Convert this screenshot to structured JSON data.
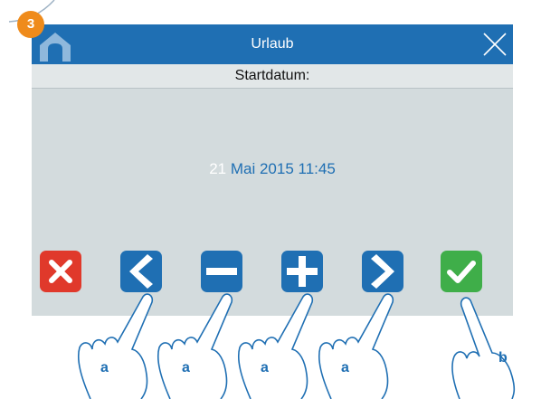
{
  "step_badge": "3",
  "titlebar": {
    "title": "Urlaub",
    "home_icon": "home-icon",
    "close_icon": "close-icon"
  },
  "subheader": {
    "label": "Startdatum:"
  },
  "datetime": {
    "day": "21",
    "rest": "Mai 2015 11:45"
  },
  "buttons": [
    {
      "name": "cancel-button",
      "icon": "cross-icon",
      "color": "#e0392b"
    },
    {
      "name": "prev-button",
      "icon": "chevron-left-icon",
      "color": "#1f6fb3"
    },
    {
      "name": "decrease-button",
      "icon": "minus-icon",
      "color": "#1f6fb3"
    },
    {
      "name": "increase-button",
      "icon": "plus-icon",
      "color": "#1f6fb3"
    },
    {
      "name": "next-button",
      "icon": "chevron-right-icon",
      "color": "#1f6fb3"
    },
    {
      "name": "confirm-button",
      "icon": "check-icon",
      "color": "#3fae49"
    }
  ],
  "hand_labels": [
    "a",
    "a",
    "a",
    "a",
    "b"
  ],
  "colors": {
    "titlebar": "#1f6fb3",
    "screen": "#d3dbdd",
    "badge": "#ef8b1b",
    "hand_outline": "#1f6fb3"
  }
}
